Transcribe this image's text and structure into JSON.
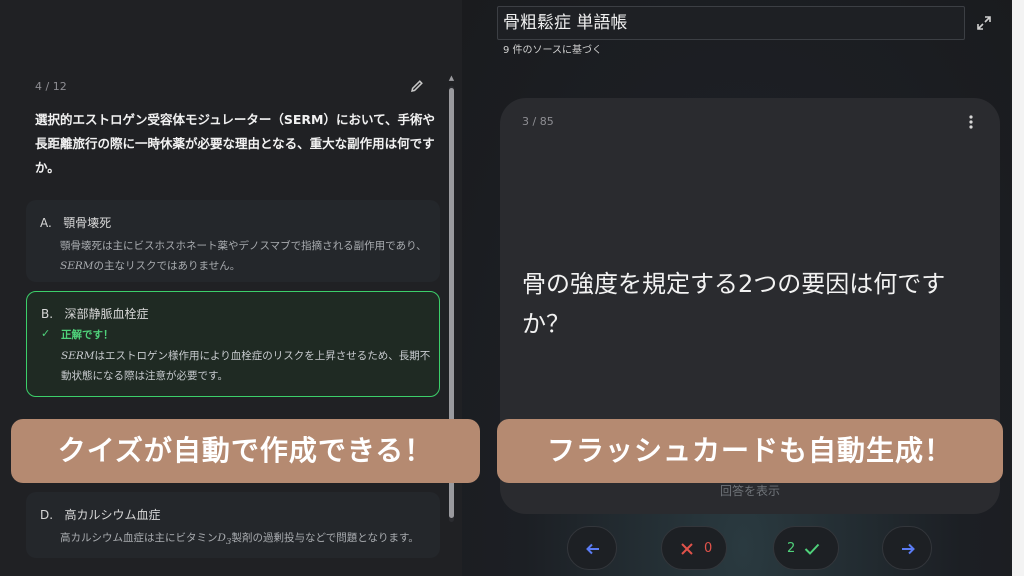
{
  "quiz": {
    "counter": "4 / 12",
    "question": "選択的エストロゲン受容体モジュレーター（SERM）において、手術や長距離旅行の際に一時休薬が必要な理由となる、重大な副作用は何ですか。",
    "options": [
      {
        "letter": "A.",
        "label": "顎骨壊死",
        "explanation_1": "顎骨壊死は主にビスホスホネート薬やデノスマブで指摘される副作用であり、",
        "explanation_math": "SERM",
        "explanation_2": "の主なリスクではありません。"
      },
      {
        "letter": "B.",
        "label": "深部静脈血栓症",
        "status": "正解です！",
        "explanation_math": "SERM",
        "explanation_1": "はエストロゲン様作用により血栓症のリスクを上昇させるため、長期不動状態になる際は注意が必要です。"
      },
      {
        "letter": "D.",
        "label": "高カルシウム血症",
        "explanation_1": "高カルシウム血症は主にビタミン",
        "explanation_math": "D",
        "explanation_sub": "3",
        "explanation_2": "製剤の過剰投与などで問題となります。"
      }
    ]
  },
  "notebook": {
    "title": "骨粗鬆症 単語帳",
    "source_note": "9 件のソースに基づく"
  },
  "flashcard": {
    "counter": "3 / 85",
    "question": "骨の強度を規定する2つの要因は何ですか？",
    "reveal_label": "回答を表示"
  },
  "controls": {
    "wrong_count": "0",
    "right_count": "2"
  },
  "banners": {
    "left": "クイズが自動で作成できる！",
    "right": "フラッシュカードも自動生成！"
  },
  "colors": {
    "correct_green": "#3ccf6a",
    "banner_bg": "#b58a71",
    "nav_blue": "#5b7cf5",
    "wrong_red": "#e0524a"
  },
  "icons": [
    "edit-icon",
    "check-icon",
    "expand-icon",
    "more-vert-icon",
    "arrow-left-icon",
    "close-icon",
    "check-icon",
    "arrow-right-icon"
  ]
}
